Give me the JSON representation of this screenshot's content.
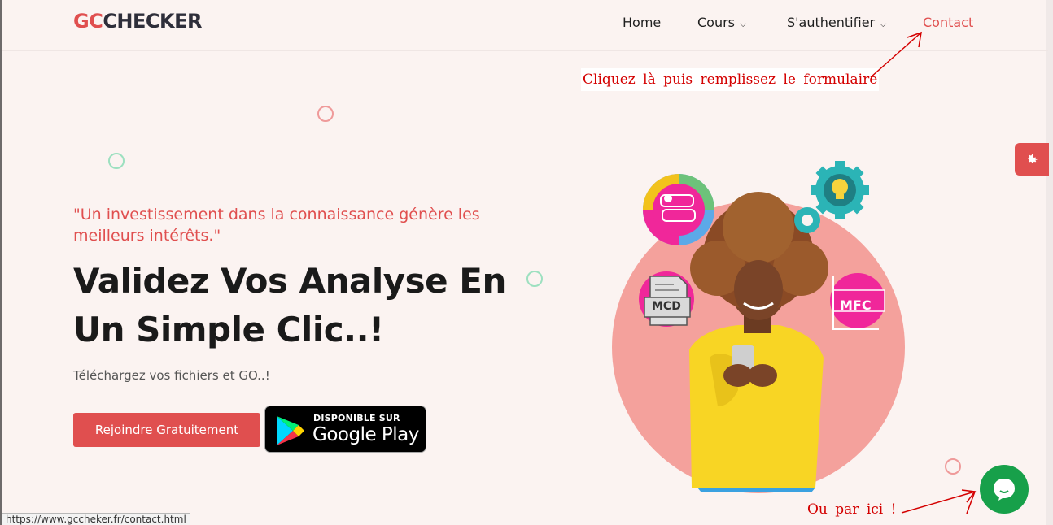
{
  "header": {
    "logo_part1": "GC",
    "logo_part2": "CHECKER",
    "nav": [
      {
        "label": "Home"
      },
      {
        "label": "Cours"
      },
      {
        "label": "S'authentifier"
      },
      {
        "label": "Contact"
      }
    ]
  },
  "annotations": {
    "top": "Cliquez là puis remplissez le formulaire",
    "bottom": "Ou par ici !"
  },
  "hero": {
    "quote": "\"Un investissement dans la connaissance génère les meilleurs intérêts.\"",
    "headline": "Validez Vos Analyse En Un Simple Clic..!",
    "subtitle": "Téléchargez vos fichiers et GO..!",
    "cta_label": "Rejoindre Gratuitement",
    "store_small": "DISPONIBLE SUR",
    "store_big": "Google Play",
    "badge_mcd": "MCD",
    "badge_mfc": "MFC"
  },
  "status_bar": {
    "url": "https://www.gccheker.fr/contact.html"
  },
  "colors": {
    "accent": "#e04f4f",
    "background": "#fbf3f1",
    "chat": "#17a04a",
    "annotation": "#d40000"
  },
  "icons": [
    "gear-icon",
    "chevron-down-icon",
    "chat-bubble-icon",
    "google-play-logo-icon",
    "arrow-annotation-icon"
  ]
}
